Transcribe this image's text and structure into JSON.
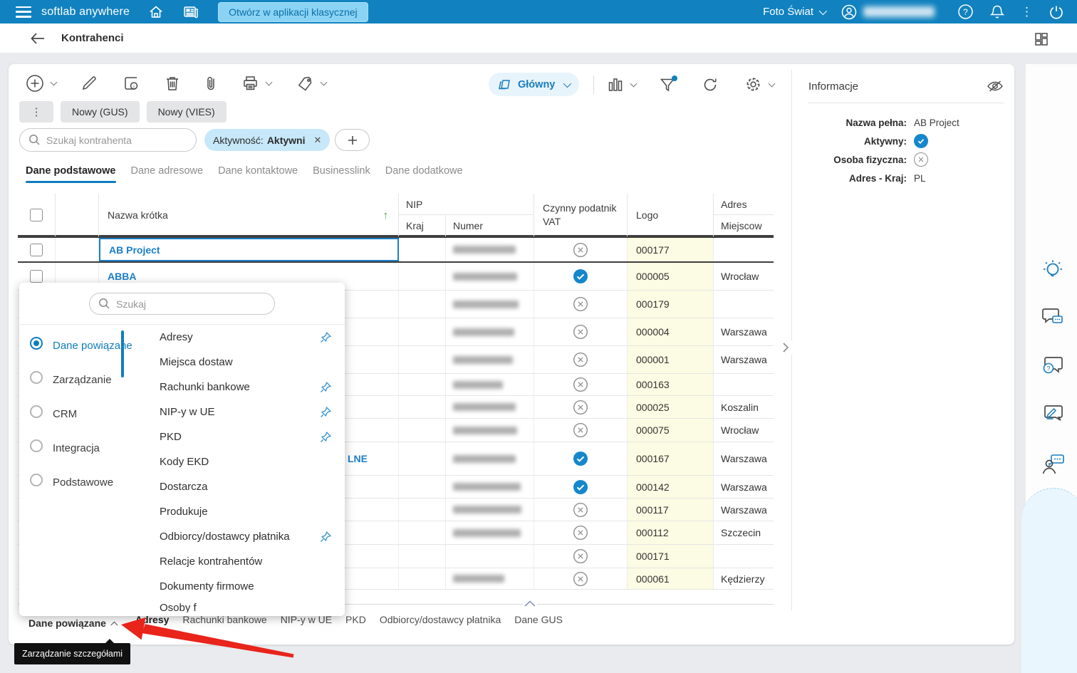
{
  "topbar": {
    "brand": "softlab anywhere",
    "open_classic_label": "Otwórz w aplikacji klasycznej",
    "company": "Foto Świat",
    "icons": [
      "menu-icon",
      "home-icon",
      "news-icon",
      "user-icon",
      "help-icon",
      "bell-icon",
      "more-icon",
      "power-icon"
    ]
  },
  "header": {
    "title": "Kontrahenci",
    "icons": [
      "back-arrow-icon",
      "layout-icon"
    ]
  },
  "toolbar": {
    "icons": [
      "add-icon",
      "edit-icon",
      "card-info-icon",
      "delete-icon",
      "attach-icon",
      "print-icon",
      "tag-icon",
      "chart-icon",
      "filter-icon",
      "refresh-icon",
      "settings-icon"
    ],
    "view_label": "Główny",
    "more_button": "⋮",
    "new_gus_label": "Nowy (GUS)",
    "new_vies_label": "Nowy (VIES)",
    "search_placeholder": "Szukaj kontrahenta",
    "filter_chip_label": "Aktywność:",
    "filter_chip_value": "Aktywni"
  },
  "tabs": [
    {
      "label": "Dane podstawowe",
      "active": true
    },
    {
      "label": "Dane adresowe",
      "active": false
    },
    {
      "label": "Dane kontaktowe",
      "active": false
    },
    {
      "label": "Businesslink",
      "active": false
    },
    {
      "label": "Dane dodatkowe",
      "active": false
    }
  ],
  "table": {
    "headers": {
      "name": "Nazwa krótka",
      "nip_group": "NIP",
      "kraj": "Kraj",
      "numer": "Numer",
      "vat": "Czynny podatnik VAT",
      "logo": "Logo",
      "adres_group": "Adres",
      "city": "Miejscow"
    },
    "rows": [
      {
        "name": "AB Project",
        "selected": true,
        "nip_blur": true,
        "vat": "no",
        "logo": "000177",
        "city": ""
      },
      {
        "name": "ABBA",
        "nip_blur": true,
        "vat": "yes",
        "logo": "000005",
        "city": "Wrocław"
      },
      {
        "name": "",
        "nip_blur": true,
        "vat": "no",
        "logo": "000179",
        "city": ""
      },
      {
        "name": "",
        "nip_blur": true,
        "vat": "no",
        "logo": "000004",
        "city": "Warszawa"
      },
      {
        "name": "",
        "nip_blur": true,
        "vat": "no",
        "logo": "000001",
        "city": "Warszawa"
      },
      {
        "name": "",
        "nip_blur": true,
        "vat": "no",
        "logo": "000163",
        "city": ""
      },
      {
        "name": "",
        "nip_blur": true,
        "vat": "no",
        "logo": "000025",
        "city": "Koszalin"
      },
      {
        "name": "",
        "nip_blur": true,
        "vat": "no",
        "logo": "000075",
        "city": "Wrocław"
      },
      {
        "name": "LNE",
        "name_partial": true,
        "nip_blur": true,
        "vat": "yes",
        "logo": "000167",
        "city": "Warszawa"
      },
      {
        "name": "",
        "nip_blur": true,
        "vat": "yes",
        "logo": "000142",
        "city": "Warszawa"
      },
      {
        "name": "",
        "nip_blur": true,
        "vat": "no",
        "logo": "000117",
        "city": "Warszawa"
      },
      {
        "name": "",
        "nip_blur": true,
        "vat": "no",
        "logo": "000112",
        "city": "Szczecin"
      },
      {
        "name": "",
        "nip_blur": false,
        "vat": "no",
        "logo": "000171",
        "city": ""
      },
      {
        "name": "",
        "nip_blur": true,
        "vat": "no",
        "logo": "000061",
        "city": "Kędzierzy"
      }
    ]
  },
  "popup": {
    "search_placeholder": "Szukaj",
    "categories": [
      {
        "label": "Dane powiązane",
        "selected": true
      },
      {
        "label": "Zarządzanie",
        "selected": false
      },
      {
        "label": "CRM",
        "selected": false
      },
      {
        "label": "Integracja",
        "selected": false
      },
      {
        "label": "Podstawowe",
        "selected": false
      }
    ],
    "items": [
      {
        "label": "Adresy",
        "pinned": true
      },
      {
        "label": "Miejsca dostaw",
        "pinned": false
      },
      {
        "label": "Rachunki bankowe",
        "pinned": true
      },
      {
        "label": "NIP-y w UE",
        "pinned": true
      },
      {
        "label": "PKD",
        "pinned": true
      },
      {
        "label": "Kody EKD",
        "pinned": false
      },
      {
        "label": "Dostarcza",
        "pinned": false
      },
      {
        "label": "Produkuje",
        "pinned": false
      },
      {
        "label": "Odbiorcy/dostawcy płatnika",
        "pinned": true
      },
      {
        "label": "Relacje kontrahentów",
        "pinned": false
      },
      {
        "label": "Dokumenty firmowe",
        "pinned": false
      },
      {
        "label": "Osoby f",
        "pinned": false,
        "partial": true
      }
    ]
  },
  "bottom_bar": {
    "label": "Dane powiązane",
    "tabs": [
      {
        "label": "Adresy",
        "active": true
      },
      {
        "label": "Rachunki bankowe",
        "active": false
      },
      {
        "label": "NIP-y w UE",
        "active": false
      },
      {
        "label": "PKD",
        "active": false
      },
      {
        "label": "Odbiorcy/dostawcy płatnika",
        "active": false
      },
      {
        "label": "Dane GUS",
        "active": false
      }
    ]
  },
  "tooltip": {
    "text": "Zarządzanie szczegółami"
  },
  "info_panel": {
    "title": "Informacje",
    "icon": "hide-eye-icon",
    "fields": [
      {
        "label": "Nazwa pełna:",
        "value": "AB Project",
        "type": "text"
      },
      {
        "label": "Aktywny:",
        "value": "",
        "type": "check"
      },
      {
        "label": "Osoba fizyczna:",
        "value": "",
        "type": "cross"
      },
      {
        "label": "Adres - Kraj:",
        "value": "PL",
        "type": "text"
      }
    ]
  },
  "right_strip": {
    "icons": [
      "idea-icon",
      "feedback-chat-icon",
      "help-chat-icon",
      "edit-note-icon",
      "contact-chat-icon"
    ]
  },
  "colors": {
    "topbar": "#1182BF",
    "accent": "#127ABF",
    "link": "#1B7ECB",
    "chip_bg": "#C7E8F8",
    "logo_col_bg": "#FCFBE3",
    "check_blue": "#1587CC",
    "cross_gray": "#8F8F8F",
    "annotation_red": "#E8241B"
  }
}
